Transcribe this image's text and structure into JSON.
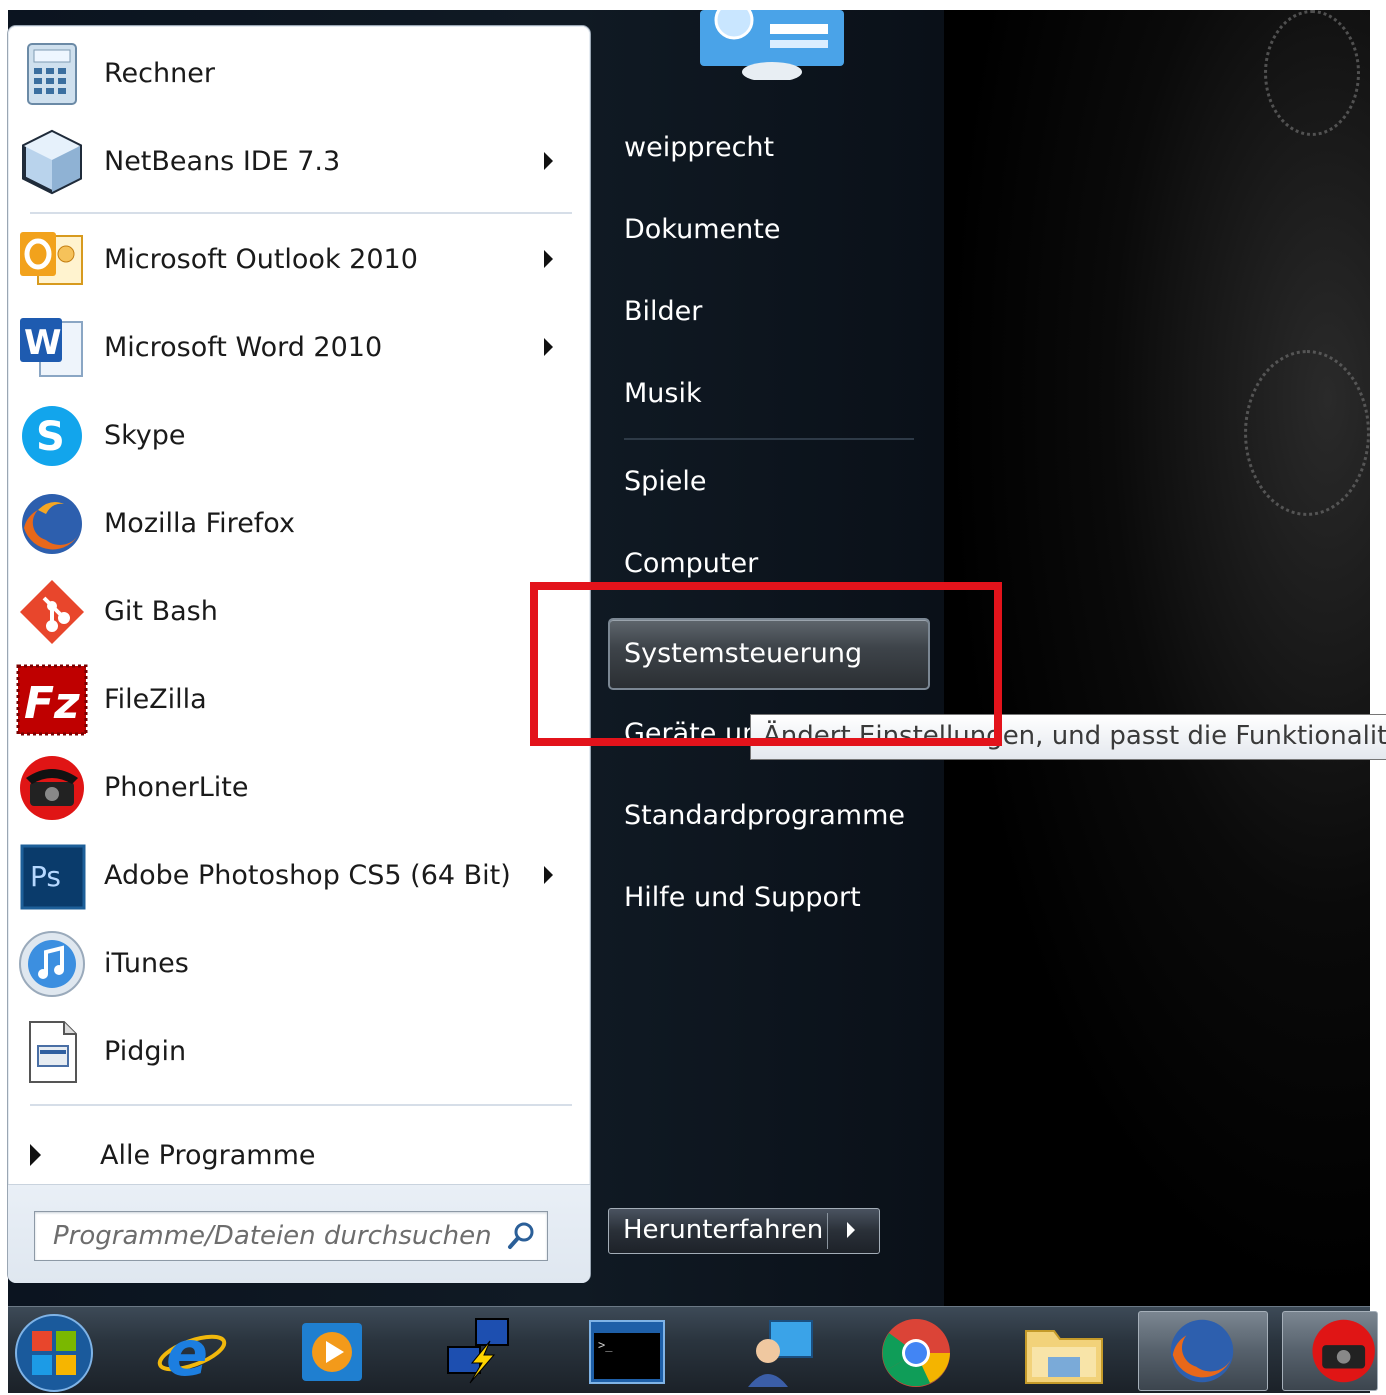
{
  "programs": [
    {
      "label": "Rechner",
      "icon": "calculator-icon",
      "has_submenu": false
    },
    {
      "label": "NetBeans IDE 7.3",
      "icon": "netbeans-icon",
      "has_submenu": true
    },
    {
      "label": "Microsoft Outlook 2010",
      "icon": "outlook-icon",
      "has_submenu": true
    },
    {
      "label": "Microsoft Word 2010",
      "icon": "word-icon",
      "has_submenu": true
    },
    {
      "label": "Skype",
      "icon": "skype-icon",
      "has_submenu": false
    },
    {
      "label": "Mozilla Firefox",
      "icon": "firefox-icon",
      "has_submenu": false
    },
    {
      "label": "Git Bash",
      "icon": "git-icon",
      "has_submenu": false
    },
    {
      "label": "FileZilla",
      "icon": "filezilla-icon",
      "has_submenu": false
    },
    {
      "label": "PhonerLite",
      "icon": "phone-icon",
      "has_submenu": false
    },
    {
      "label": "Adobe Photoshop CS5 (64 Bit)",
      "icon": "photoshop-icon",
      "has_submenu": true
    },
    {
      "label": "iTunes",
      "icon": "itunes-icon",
      "has_submenu": false
    },
    {
      "label": "Pidgin",
      "icon": "pidgin-icon",
      "has_submenu": false
    }
  ],
  "all_programs": {
    "label": "Alle Programme"
  },
  "search": {
    "placeholder": "Programme/Dateien durchsuchen"
  },
  "right_panel": {
    "user": "weipprecht",
    "documents": "Dokumente",
    "pictures": "Bilder",
    "music": "Musik",
    "games": "Spiele",
    "computer": "Computer",
    "control_panel": "Systemsteuerung",
    "devices_partial": "Geräte und",
    "default_programs": "Standardprogramme",
    "help": "Hilfe und Support"
  },
  "tooltip": {
    "text": "Ändert Einstellungen, und passt die Funktionalität"
  },
  "shutdown": {
    "label": "Herunterfahren"
  },
  "taskbar": {
    "items": [
      "start-orb-icon",
      "internet-explorer-icon",
      "media-player-icon",
      "network-icon",
      "console-icon",
      "remote-desktop-icon",
      "chrome-icon",
      "file-explorer-icon",
      "firefox-icon",
      "phone-icon"
    ]
  },
  "colors": {
    "annotation": "#e3131b",
    "menu_dark": "#0b1420"
  }
}
